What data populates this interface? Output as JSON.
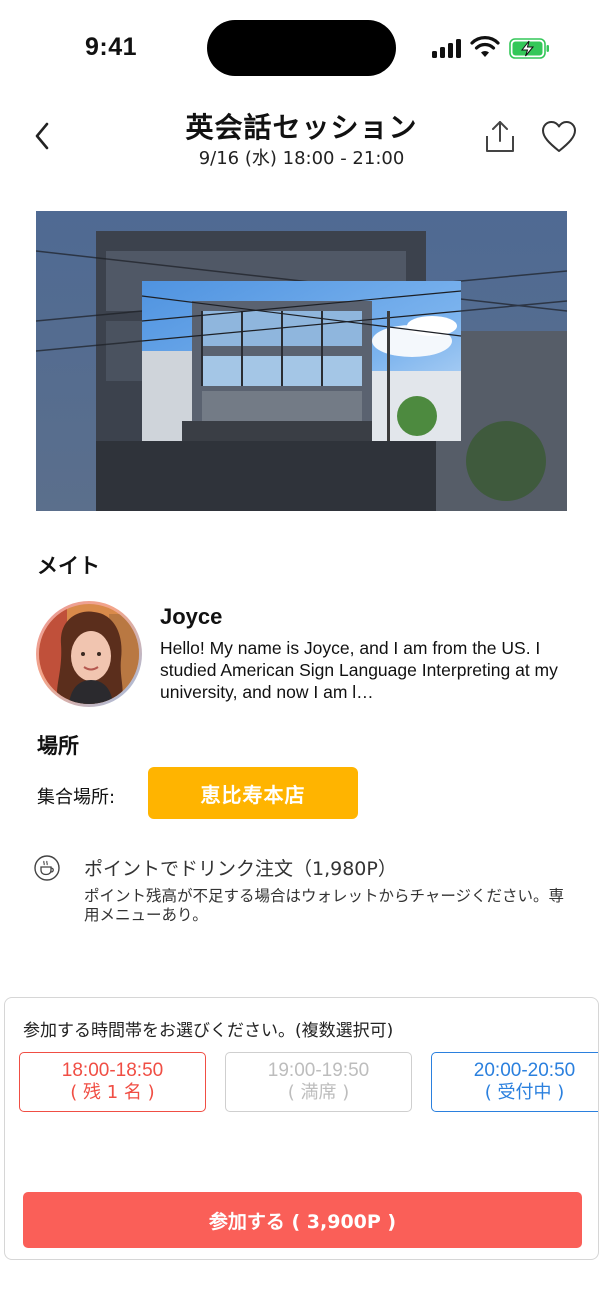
{
  "status_bar": {
    "time": "9:41"
  },
  "header": {
    "title": "英会話セッション",
    "subtitle": "9/16 (水) 18:00 - 21:00"
  },
  "mate": {
    "heading": "メイト",
    "name": "Joyce",
    "bio": "Hello! My name is Joyce, and I am from the US. I studied American Sign Language Interpreting at my university, and now I am l…"
  },
  "location": {
    "heading": "場所",
    "label": "集合場所:",
    "place": "恵比寿本店"
  },
  "drink": {
    "icon": "coffee-cup-icon",
    "title": "ポイントでドリンク注文（1,980P）",
    "note": "ポイント残高が不足する場合はウォレットからチャージください。専用メニューあり。"
  },
  "booking": {
    "prompt": "参加する時間帯をお選びください。(複数選択可)",
    "slots": [
      {
        "time": "18:00-18:50",
        "status": "( 残 1 名 )",
        "color": "#f04e44"
      },
      {
        "time": "19:00-19:50",
        "status": "( 満席 )",
        "color": "#bdbdbd"
      },
      {
        "time": "20:00-20:50",
        "status": "( 受付中 )",
        "color": "#2b80de"
      }
    ],
    "join_label": "参加する ( 3,900P )"
  },
  "colors": {
    "accent_orange": "#ffb400",
    "join_red": "#fa5f58"
  }
}
